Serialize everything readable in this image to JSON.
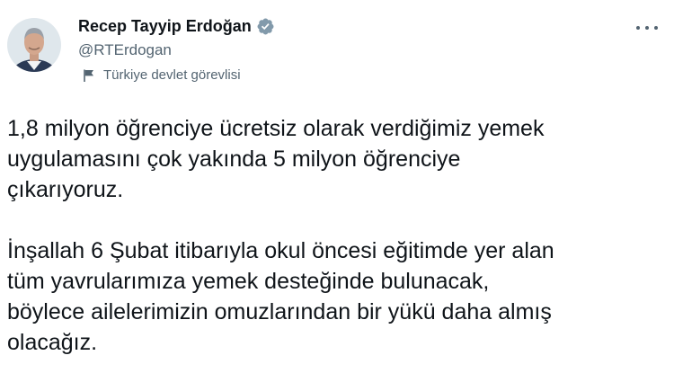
{
  "author": {
    "display_name": "Recep Tayyip Erdoğan",
    "handle": "@RTErdogan",
    "affiliation": "Türkiye devlet görevlisi",
    "verified": true,
    "avatar_icon": "profile-photo",
    "label_icon": "flag-icon",
    "verified_color": "#829aab"
  },
  "menu": {
    "more_icon": "more-options-icon"
  },
  "tweet": {
    "paragraphs": [
      "1,8 milyon öğrenciye ücretsiz olarak verdiğimiz yemek\nuygulamasını çok yakında 5 milyon öğrenciye\nçıkarıyoruz.",
      "İnşallah 6 Şubat itibarıyla okul öncesi eğitimde yer alan\ntüm yavrularımıza yemek desteğinde bulunacak,\nböylece ailelerimizin omuzlarından bir yükü daha almış\nolacağız."
    ]
  }
}
